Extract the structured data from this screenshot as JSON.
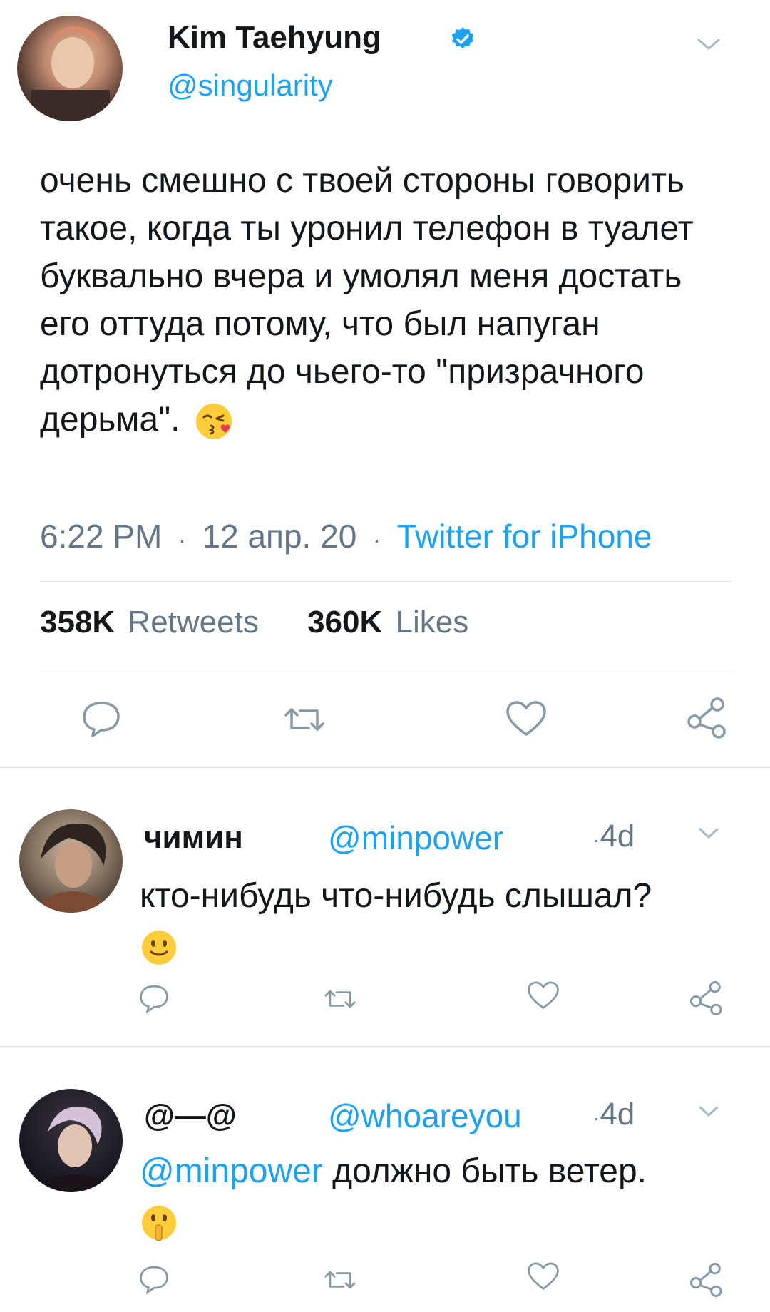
{
  "main_tweet": {
    "author_name": "Kim Taehyung",
    "author_handle": "@singularity",
    "verified_icon": "verified-badge-icon",
    "text": "очень смешно с твоей стороны говорить такое, когда ты уронил телефон в туалет буквально вчера и умолял меня достать его оттуда потому, что был напуган дотронуться до чьего-то \"призрачного дерьма\".",
    "emoji": "face-blowing-kiss",
    "time": "6:22 PM",
    "date": "12 апр. 20",
    "source": "Twitter for iPhone",
    "retweets_count": "358K",
    "retweets_label": "Retweets",
    "likes_count": "360K",
    "likes_label": "Likes"
  },
  "replies": [
    {
      "name": "чимин",
      "handle": "@minpower",
      "time": "4d",
      "mention": "",
      "text": "кто-нибудь что-нибудь слышал?",
      "emoji": "slightly-smiling-face"
    },
    {
      "name": "@—@",
      "handle": "@whoareyou",
      "time": "4d",
      "mention": "@minpower",
      "text": "должно быть ветер.",
      "emoji": "shushing-face"
    }
  ],
  "dot": "·",
  "colors": {
    "link": "#1da1f2",
    "text": "#14171a",
    "muted": "#657786",
    "icon": "#8899a6",
    "divider": "#e1e8ed"
  }
}
